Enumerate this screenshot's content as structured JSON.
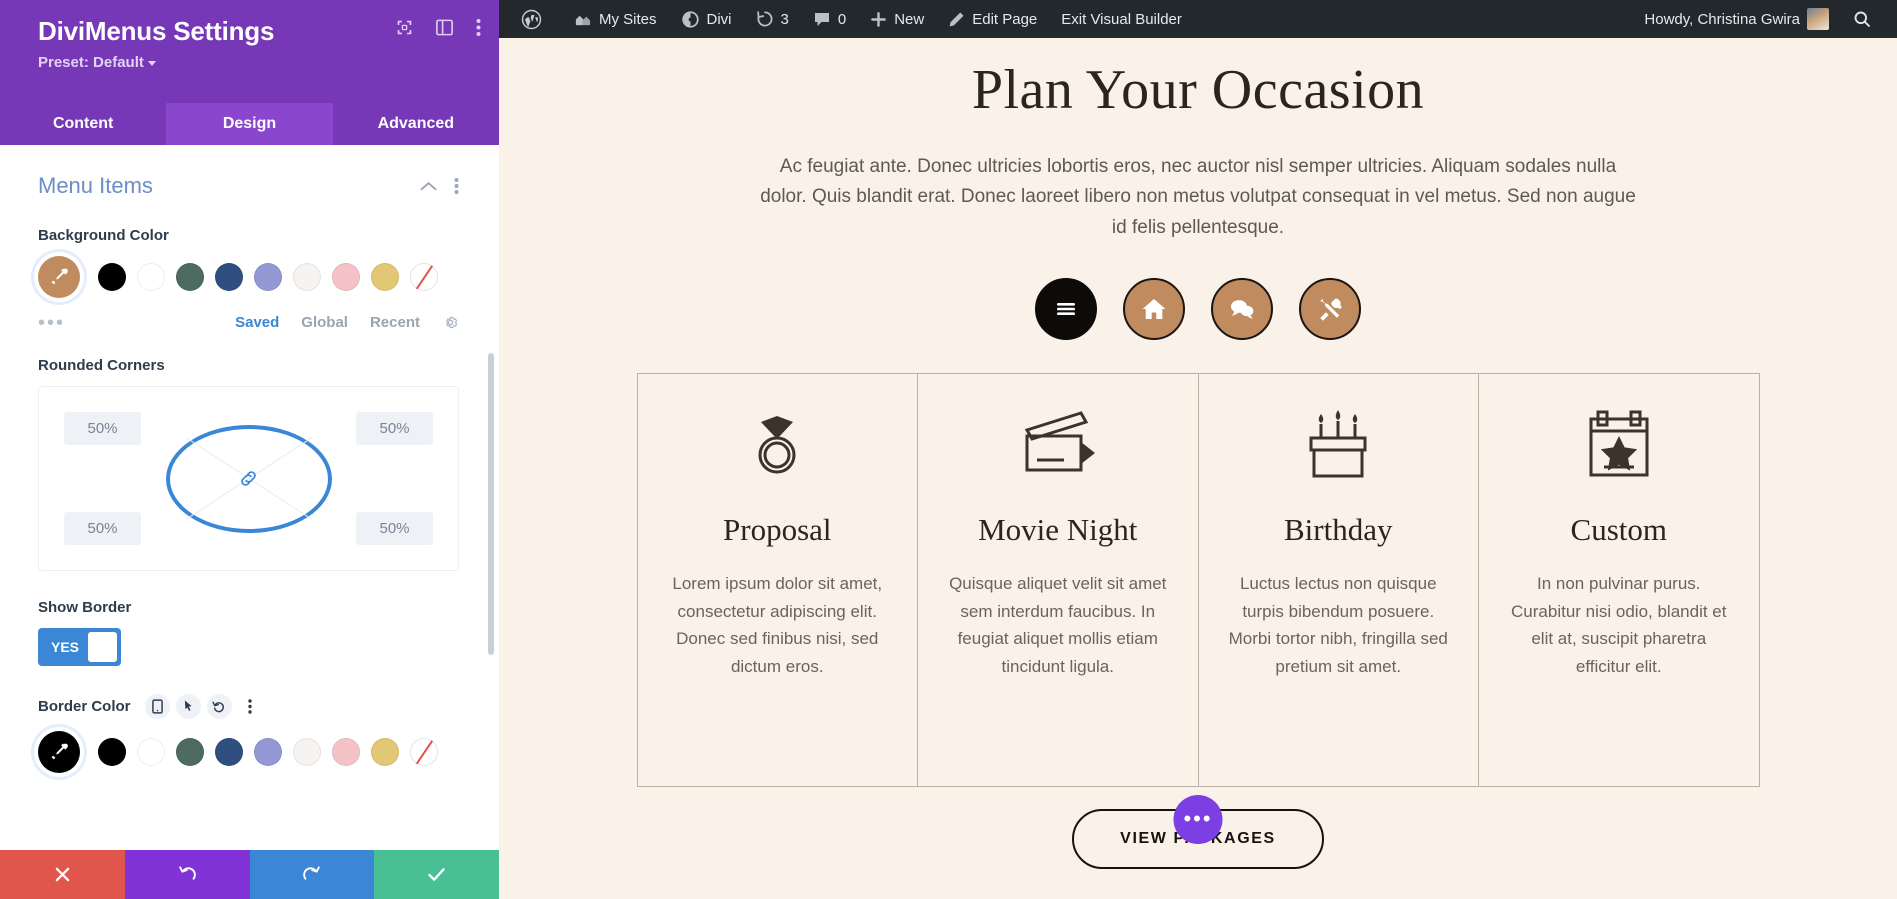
{
  "settings": {
    "title": "DiviMenus Settings",
    "preset": "Preset: Default",
    "header_icons": [
      "target-icon",
      "layout-icon",
      "more-vertical-icon"
    ],
    "tabs": [
      {
        "label": "Content",
        "active": false
      },
      {
        "label": "Design",
        "active": true
      },
      {
        "label": "Advanced",
        "active": false
      }
    ],
    "section": {
      "title": "Menu Items",
      "collapse_icon": "chevron-up-icon",
      "more_icon": "more-vertical-icon"
    },
    "background_color": {
      "label": "Background Color",
      "selected": "#c08b5e",
      "swatches": [
        "#000000",
        "#ffffff",
        "#4e6b61",
        "#2e4f7f",
        "#9498d4",
        "#f6f3f0",
        "#f3c3c7",
        "#e0c濾"
      ],
      "palette": [
        "#000000",
        "#ffffff",
        "#4e6b61",
        "#2e4f7f",
        "#9498d4",
        "#f6f3f0",
        "#f3c3c7",
        "#e2c874",
        "none"
      ],
      "more_label": "•••",
      "tabs": [
        {
          "label": "Saved",
          "active": true
        },
        {
          "label": "Global",
          "active": false
        },
        {
          "label": "Recent",
          "active": false
        }
      ],
      "gear_icon": "gear-icon"
    },
    "rounded_corners": {
      "label": "Rounded Corners",
      "top_left": "50%",
      "top_right": "50%",
      "bottom_left": "50%",
      "bottom_right": "50%",
      "link_icon": "link-icon"
    },
    "show_border": {
      "label": "Show Border",
      "value": "YES"
    },
    "border_color": {
      "label": "Border Color",
      "selected": "#000000",
      "icons": [
        "mobile-icon",
        "cursor-icon",
        "reset-icon",
        "more-vertical-icon"
      ],
      "palette": [
        "#000000",
        "#ffffff",
        "#4e6b61",
        "#2e4f7f",
        "#9498d4",
        "#f6f3f0",
        "#f3c3c7",
        "#e2c874",
        "none"
      ]
    },
    "footer": {
      "cancel_icon": "close-icon",
      "undo_icon": "undo-icon",
      "redo_icon": "redo-icon",
      "save_icon": "check-icon"
    }
  },
  "adminbar": {
    "items": [
      {
        "icon": "wordpress-icon",
        "label": ""
      },
      {
        "icon": "sites-icon",
        "label": "My Sites"
      },
      {
        "icon": "divi-icon",
        "label": "Divi"
      },
      {
        "icon": "updates-icon",
        "label": "3"
      },
      {
        "icon": "comments-icon",
        "label": "0"
      },
      {
        "icon": "plus-icon",
        "label": "New"
      },
      {
        "icon": "pencil-icon",
        "label": "Edit Page"
      },
      {
        "icon": "",
        "label": "Exit Visual Builder"
      }
    ],
    "howdy": "Howdy, Christina Gwira",
    "avatar": "user-avatar",
    "search_icon": "search-icon"
  },
  "page": {
    "title": "Plan Your Occasion",
    "subtitle": "Ac feugiat ante. Donec ultricies lobortis eros, nec auctor nisl semper ultricies. Aliquam sodales nulla dolor. Quis blandit erat. Donec laoreet libero non metus volutpat consequat in vel metus. Sed non augue id felis pellentesque.",
    "circle_buttons": [
      {
        "icon": "hamburger-icon",
        "style": "dark"
      },
      {
        "icon": "home-icon",
        "style": "tan"
      },
      {
        "icon": "chat-icon",
        "style": "tan"
      },
      {
        "icon": "tools-icon",
        "style": "tan"
      }
    ],
    "cards": [
      {
        "icon": "ring-icon",
        "title": "Proposal",
        "text": "Lorem ipsum dolor sit amet, consectetur adipiscing elit. Donec sed finibus nisi, sed dictum eros."
      },
      {
        "icon": "clapperboard-icon",
        "title": "Movie Night",
        "text": "Quisque aliquet velit sit amet sem interdum faucibus. In feugiat aliquet mollis etiam tincidunt ligula."
      },
      {
        "icon": "cake-icon",
        "title": "Birthday",
        "text": "Luctus lectus non quisque turpis bibendum posuere. Morbi tortor nibh, fringilla sed pretium sit amet."
      },
      {
        "icon": "calendar-star-icon",
        "title": "Custom",
        "text": "In non pulvinar purus. Curabitur nisi odio, blandit et elit at, suscipit pharetra efficitur elit."
      }
    ],
    "cta_label": "VIEW PACKAGES",
    "cta_badge": "•••"
  },
  "colors": {
    "panel_purple": "#7638b6",
    "tab_active": "#8a47ce",
    "accent_blue": "#3b87d6",
    "tan": "#c08b5e",
    "page_bg": "#faf1e8"
  }
}
